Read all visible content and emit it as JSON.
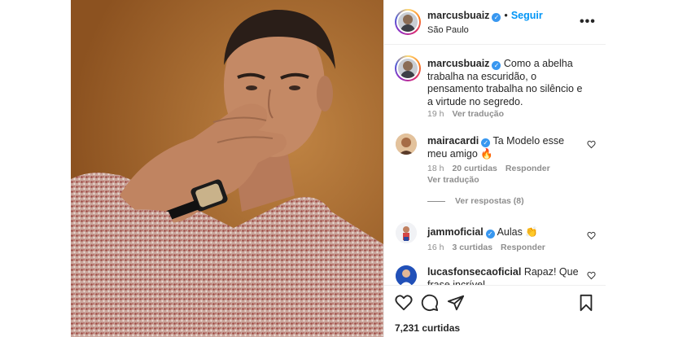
{
  "post": {
    "username": "marcusbuaiz",
    "follow_label": "Seguir",
    "separator": "•",
    "location": "São Paulo",
    "more_label": "•••"
  },
  "caption": {
    "username": "marcusbuaiz",
    "text": "Como a abelha trabalha na escuridão, o pensamento trabalha no silêncio e a virtude no segredo.",
    "time": "19 h",
    "translate": "Ver tradução"
  },
  "comments": [
    {
      "username": "mairacardi",
      "text": "Ta Modelo esse meu amigo 🔥",
      "time": "18 h",
      "likes": "20 curtidas",
      "reply": "Responder",
      "translate": "Ver tradução",
      "view_replies": "Ver respostas (8)"
    },
    {
      "username": "jammoficial",
      "text": "Aulas 👏",
      "time": "16 h",
      "likes": "3 curtidas",
      "reply": "Responder"
    },
    {
      "username": "lucasfonsecaoficial",
      "text": "Rapaz! Que frase incrível"
    }
  ],
  "footer": {
    "likes": "7,231 curtidas"
  },
  "icons": {
    "verified": "verified-badge-icon",
    "heart": "heart-icon",
    "comment": "comment-icon",
    "share": "paper-plane-icon",
    "save": "bookmark-icon"
  },
  "colors": {
    "link": "#0095f6",
    "verified": "#3897f0",
    "muted": "#8e8e8e",
    "text": "#262626"
  }
}
